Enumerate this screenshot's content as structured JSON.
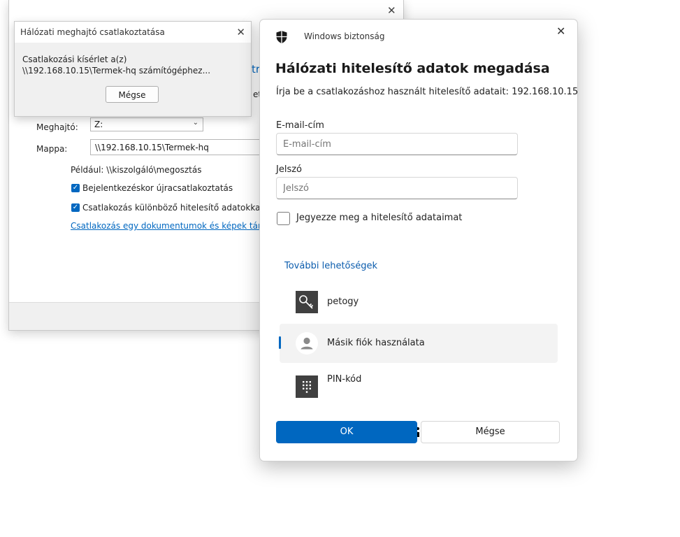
{
  "background_window": {
    "drive_label": "Meghajtó:",
    "drive_value": "Z:",
    "folder_label": "Mappa:",
    "folder_value": "\\\\192.168.10.15\\Termek-hq",
    "example_text": "Például: \\\\kiszolgáló\\megosztás",
    "reconnect_label": "Bejelentkezéskor újracsatlakoztatás",
    "different_creds_label": "Csatlakozás különböző hitelesítő adatokkal",
    "link_text": "Csatlakozás egy dokumentumok és képek tárolására",
    "cut_off_heading": "tr",
    "cut_off_text": "et"
  },
  "progress_dialog": {
    "title": "Hálózati meghajtó csatlakoztatása",
    "message": "Csatlakozási kísérlet a(z) \\\\192.168.10.15\\Termek-hq számítógéphez...",
    "cancel_label": "Mégse"
  },
  "security_dialog": {
    "app_title": "Windows biztonság",
    "heading": "Hálózati hitelesítő adatok megadása",
    "subtitle": "Írja be a csatlakozáshoz használt hitelesítő adatait: 192.168.10.15",
    "email_label": "E-mail-cím",
    "email_placeholder": "E-mail-cím",
    "password_label": "Jelszó",
    "password_placeholder": "Jelszó",
    "remember_label": "Jegyezze meg a hitelesítő adataimat",
    "more_options": "További lehetőségek",
    "options": [
      {
        "name": "petogy",
        "icon": "key-icon"
      },
      {
        "name": "Másik fiók használata",
        "icon": "person-icon",
        "selected": true
      },
      {
        "name": "PIN-kód",
        "icon": "pin-keypad-icon"
      }
    ],
    "ok_label": "OK",
    "cancel_label": "Mégse"
  },
  "colors": {
    "accent": "#0067c0",
    "link": "#0b5cad",
    "icon_tile": "#404040"
  }
}
